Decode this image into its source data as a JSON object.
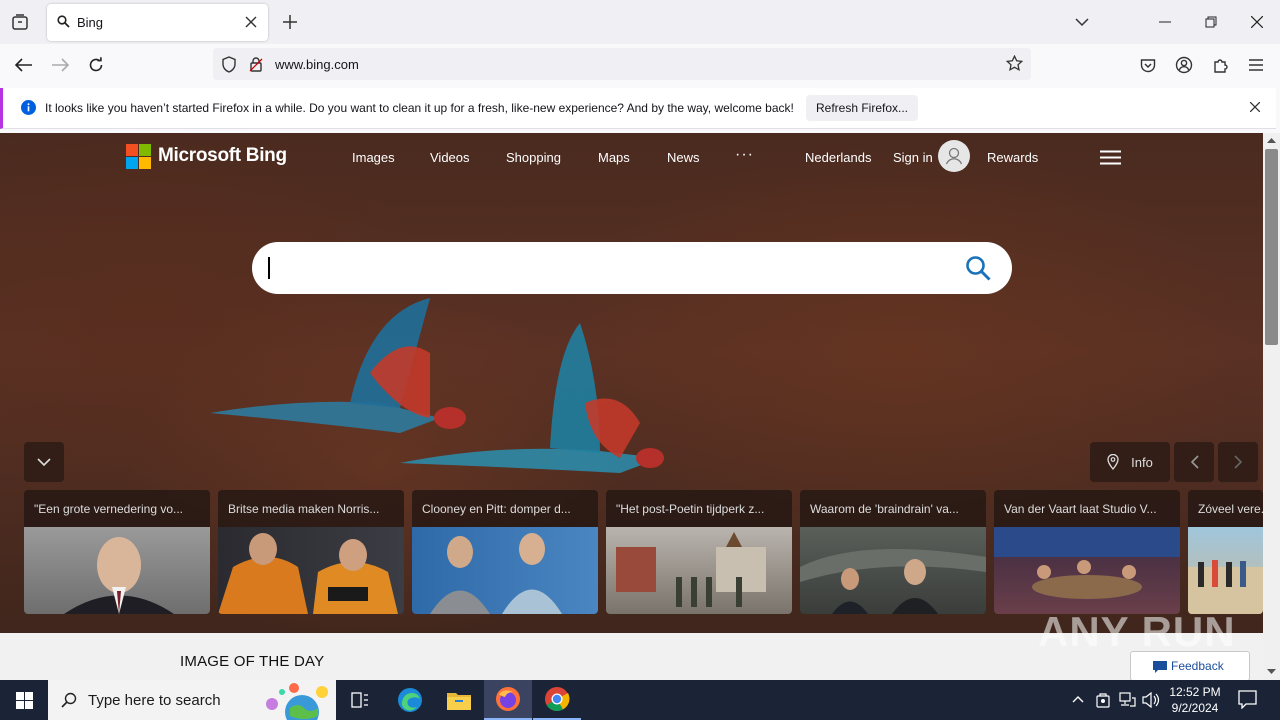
{
  "browser": {
    "tab_title": "Bing",
    "url": "www.bing.com",
    "notification": {
      "message": "It looks like you haven’t started Firefox in a while. Do you want to clean it up for a fresh, like-new experience? And by the way, welcome back!",
      "button": "Refresh Firefox..."
    }
  },
  "bing": {
    "logo": "Microsoft Bing",
    "nav": [
      "Images",
      "Videos",
      "Shopping",
      "Maps",
      "News"
    ],
    "more": "···",
    "language": "Nederlands",
    "sign_in": "Sign in",
    "rewards": "Rewards",
    "info_label": "Info",
    "cards": [
      {
        "title": "\"Een grote vernedering vo...",
        "thumb_color": "#8a8a8a"
      },
      {
        "title": "Britse media maken Norris...",
        "thumb_color": "#c26a22"
      },
      {
        "title": "Clooney en Pitt: domper d...",
        "thumb_color": "#3f6fa8"
      },
      {
        "title": "\"Het post-Poetin tijdperk z...",
        "thumb_color": "#7d7670"
      },
      {
        "title": "Waarom de 'braindrain' va...",
        "thumb_color": "#4a4f4a"
      },
      {
        "title": "Van der Vaart laat Studio V...",
        "thumb_color": "#7a4a5a"
      },
      {
        "title": "Zóveel vere...",
        "thumb_color": "#6a9ab8"
      }
    ],
    "image_of_the_day": "IMAGE OF THE DAY",
    "feedback": "Feedback",
    "watermark": "ANY RUN"
  },
  "taskbar": {
    "search_placeholder": "Type here to search",
    "time": "12:52 PM",
    "date": "9/2/2024"
  },
  "colors": {
    "bing_search_icon": "#1a73b8",
    "notif_accent": "#b833e1",
    "taskbar": "#1b2436"
  }
}
